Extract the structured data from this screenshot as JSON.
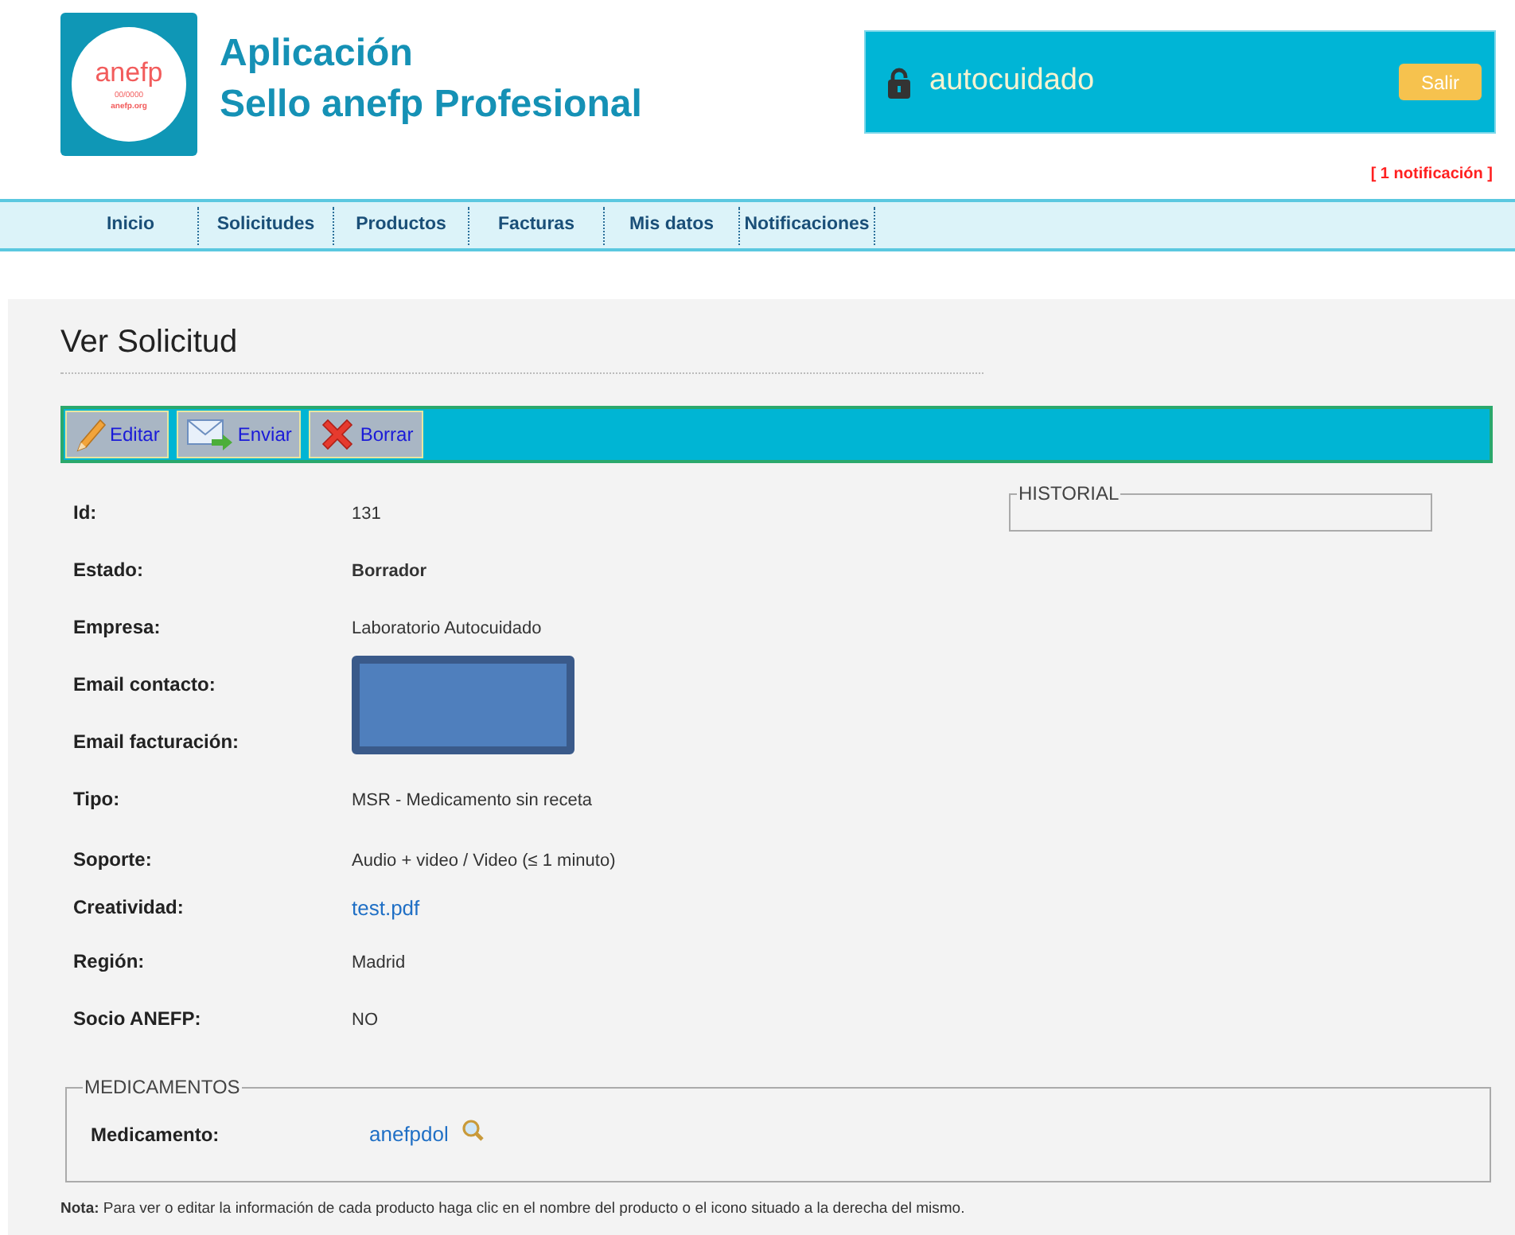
{
  "header": {
    "logo": {
      "name": "anefp",
      "code": "00/0000",
      "site": "anefp.org"
    },
    "title_lines": [
      "Aplicación",
      "Sello anefp Profesional"
    ],
    "user": "autocuidado",
    "logout": "Salir",
    "notifications": "[ 1 notificación ]"
  },
  "nav": [
    {
      "label": "Inicio"
    },
    {
      "label": "Solicitudes"
    },
    {
      "label": "Productos"
    },
    {
      "label": "Facturas"
    },
    {
      "label": "Mis datos"
    },
    {
      "label": "Notificaciones"
    }
  ],
  "page_title": "Ver Solicitud",
  "toolbar": [
    {
      "label": "Editar",
      "kind": "edit"
    },
    {
      "label": "Enviar",
      "kind": "send"
    },
    {
      "label": "Borrar",
      "kind": "delete"
    }
  ],
  "fields": [
    {
      "label": "Id:",
      "value": "131",
      "kind": "text"
    },
    {
      "label": "Estado:",
      "value": "Borrador",
      "kind": "bold"
    },
    {
      "label": "Empresa:",
      "value": "Laboratorio Autocuidado",
      "kind": "text"
    },
    {
      "label": "Email contacto:",
      "kind": "redacted"
    },
    {
      "label": "Email facturación:",
      "kind": "redacted"
    },
    {
      "label": "Tipo:",
      "value": "MSR - Medicamento sin receta",
      "kind": "text"
    },
    {
      "label": "Soporte:",
      "value": "Audio + video / Video (≤ 1 minuto)",
      "kind": "text"
    },
    {
      "label": "Creatividad:",
      "value": "test.pdf",
      "kind": "link"
    },
    {
      "label": "Región:",
      "value": "Madrid",
      "kind": "text"
    },
    {
      "label": "Socio ANEFP:",
      "value": "NO",
      "kind": "text"
    }
  ],
  "history": {
    "legend": "HISTORIAL"
  },
  "medicines": {
    "legend": "MEDICAMENTOS",
    "label": "Medicamento:",
    "value": "anefpdol"
  },
  "note": "**Nota:** Para ver o editar la información de cada producto haga clic en el nombre del producto o el icono situado a la derecha del mismo."
}
